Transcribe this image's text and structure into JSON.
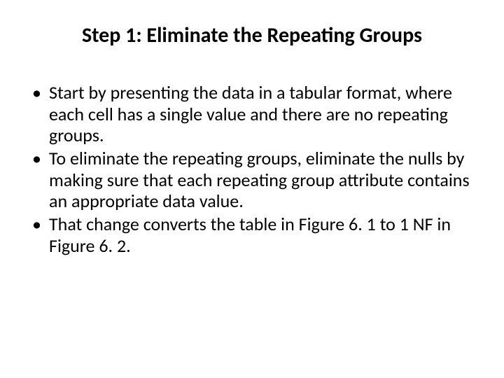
{
  "title": "Step 1: Eliminate the Repeating Groups",
  "bullets": [
    "Start by presenting the data in a tabular format, where each cell has a single value and there are no repeating groups.",
    "To eliminate the repeating groups, eliminate the nulls by making sure that each repeating group attribute contains an appropriate data value.",
    "That change converts the table in Figure 6. 1 to 1 NF in Figure 6. 2."
  ]
}
